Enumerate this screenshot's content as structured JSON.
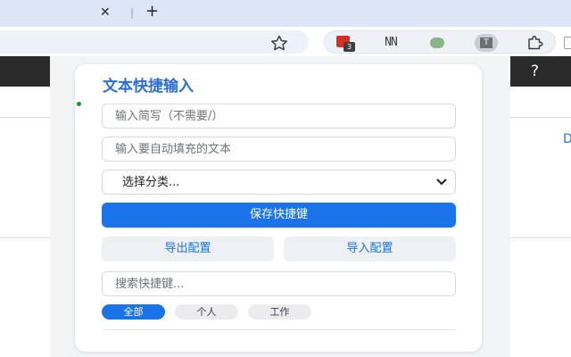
{
  "browser": {
    "tab_close_glyph": "✕",
    "new_tab_glyph": "+",
    "extensions": {
      "red_badge_count": "3",
      "nn_icon_text": "NN",
      "t_icon_text": "T"
    }
  },
  "page": {
    "help_glyph": "?",
    "right_edge_text": "D"
  },
  "popup": {
    "title": "文本快捷输入",
    "abbr_placeholder": "输入简写（不需要/）",
    "text_placeholder": "输入要自动填充的文本",
    "category_select_value": "选择分类...",
    "save_button": "保存快捷键",
    "export_button": "导出配置",
    "import_button": "导入配置",
    "search_placeholder": "搜索快捷键...",
    "filters": [
      {
        "label": "全部",
        "active": true
      },
      {
        "label": "个人",
        "active": false
      },
      {
        "label": "工作",
        "active": false
      }
    ]
  },
  "colors": {
    "accent": "#1a73e8",
    "title": "#2a6ed6",
    "tabstrip": "#dde6f7"
  }
}
